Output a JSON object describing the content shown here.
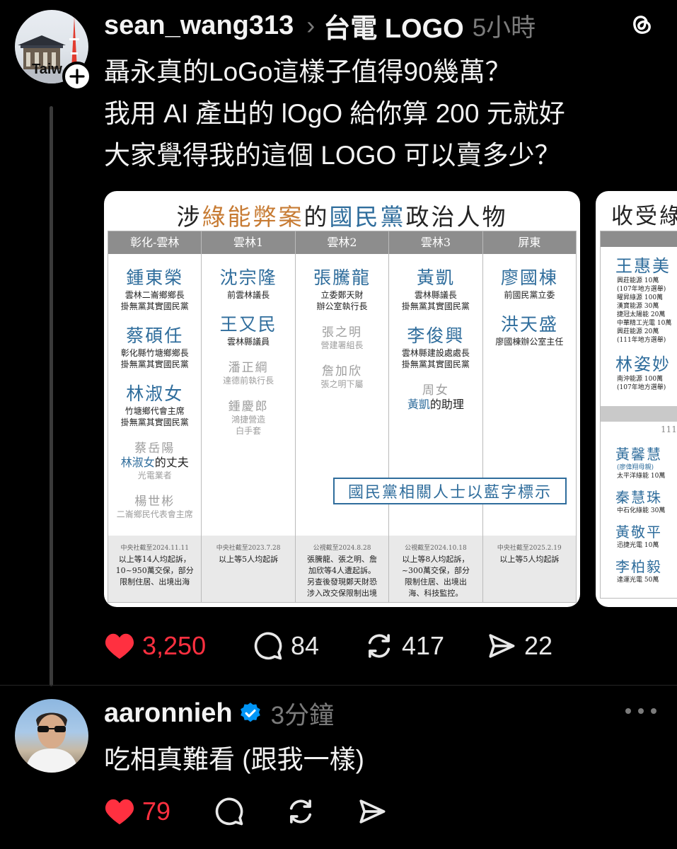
{
  "post": {
    "username": "sean_wang313",
    "separator": "›",
    "topic": "台電 LOGO",
    "time": "5小時",
    "avatar_label": "Taiw",
    "lines": [
      "聶永真的LoGo這樣子值得90幾萬？",
      "我用 AI 產出的 lOgO 給你算 200 元就好",
      "大家覺得我的這個 LOGO 可以賣多少？"
    ],
    "stats": {
      "likes": "3,250",
      "comments": "84",
      "reposts": "417",
      "shares": "22"
    }
  },
  "image1": {
    "title_parts": [
      "涉",
      "綠能弊案",
      "的",
      "國民黨",
      "政治人物"
    ],
    "columns": [
      {
        "header": "彰化-雲林",
        "people": [
          {
            "name": "鍾東榮",
            "titles": [
              "雲林二崙鄉鄉長",
              "掛無黨其實國民黨"
            ],
            "grey": false
          },
          {
            "name": "蔡碩任",
            "titles": [
              "彰化縣竹塘鄉鄉長",
              "掛無黨其實國民黨"
            ],
            "grey": false
          },
          {
            "name": "林淑女",
            "titles": [
              "竹塘鄉代會主席",
              "掛無黨其實國民黨"
            ],
            "grey": false
          },
          {
            "name": "蔡岳陽",
            "note_blue": "林淑女",
            "note_rest": "的丈夫",
            "titles": [
              "光電業者"
            ],
            "grey": true
          },
          {
            "name": "楊世彬",
            "titles": [
              "二崙鄉民代表會主席"
            ],
            "grey": true
          }
        ],
        "footer": {
          "source": "中央社截至2024.11.11",
          "lines": [
            "以上等14人均起訴，",
            "10~950萬交保，部分",
            "限制住居、出境出海"
          ]
        }
      },
      {
        "header": "雲林1",
        "people": [
          {
            "name": "沈宗隆",
            "titles": [
              "前雲林議長"
            ],
            "grey": false
          },
          {
            "name": "王又民",
            "titles": [
              "雲林縣議員"
            ],
            "grey": false
          },
          {
            "name": "潘正綱",
            "titles": [
              "達德前執行長"
            ],
            "grey": true
          },
          {
            "name": "鍾慶郎",
            "titles": [
              "鴻捷營造",
              "白手套"
            ],
            "grey": true
          }
        ],
        "footer": {
          "source": "中央社截至2023.7.28",
          "lines": [
            "以上等5人均起訴"
          ]
        }
      },
      {
        "header": "雲林2",
        "people": [
          {
            "name": "張騰龍",
            "titles": [
              "立委鄭天財",
              "辦公室執行長"
            ],
            "grey": false
          },
          {
            "name": "張之明",
            "titles": [
              "營建署組長"
            ],
            "grey": true
          },
          {
            "name": "詹加欣",
            "titles": [
              "張之明下屬"
            ],
            "grey": true
          }
        ],
        "footer": {
          "source": "公視截至2024.8.28",
          "lines": [
            "張騰龍、張之明、詹",
            "加欣等4人遭起訴。",
            "另查後發現鄭天財恐",
            "涉入改交保限制出境"
          ]
        }
      },
      {
        "header": "雲林3",
        "people": [
          {
            "name": "黃凱",
            "titles": [
              "雲林縣議長",
              "掛無黨其實國民黨"
            ],
            "grey": false
          },
          {
            "name": "李俊興",
            "titles": [
              "雲林縣建設處處長",
              "掛無黨其實國民黨"
            ],
            "grey": false
          },
          {
            "name": "周女",
            "note_blue": "黃凱",
            "note_rest": "的助理",
            "titles": [],
            "grey": true
          }
        ],
        "footer": {
          "source": "公視截至2024.10.18",
          "lines": [
            "以上等8人均起訴，",
            "~300萬交保，部分",
            "限制住居、出境出",
            "海、科技監控。"
          ]
        }
      },
      {
        "header": "屏東",
        "people": [
          {
            "name": "廖國棟",
            "titles": [
              "前國民黨立委"
            ],
            "grey": false
          },
          {
            "name": "洪天盛",
            "titles": [
              "廖國棟辦公室主任"
            ],
            "grey": false
          }
        ],
        "footer": {
          "source": "中央社截至2025.2.19",
          "lines": [
            "以上等5人均起訴"
          ]
        }
      }
    ],
    "legend": "國民黨相關人士以藍字標示"
  },
  "image2": {
    "title": "收受綠",
    "people_top": [
      {
        "name": "王惠美",
        "lines": [
          "興莊能源 10萬",
          "(107年地方選舉)",
          "曜昇綠源 100萬",
          "漢寶能源 30萬",
          "捷冠太陽能 20萬",
          "中華精工光電 10萬",
          "興莊能源 20萬",
          "(111年地方選舉)"
        ]
      },
      {
        "name": "林姿妙",
        "lines": [
          "南沖能源 100萬",
          "(107年地方選舉)"
        ]
      }
    ],
    "section_label": "111",
    "people_bottom": [
      {
        "name": "黃馨慧",
        "lines": [
          "(廖偉翔母親)",
          "太平洋綠能 10萬"
        ]
      },
      {
        "name": "秦慧珠",
        "lines": [
          "中石化綠能 30萬"
        ]
      },
      {
        "name": "黃敬平",
        "lines": [
          "迅捷光電 10萬"
        ]
      },
      {
        "name": "李柏毅",
        "lines": [
          "達運光電 50萬"
        ]
      }
    ]
  },
  "reply": {
    "username": "aaronnieh",
    "time": "3分鐘",
    "text": "吃相真難看 (跟我一樣)",
    "stats": {
      "likes": "79"
    }
  },
  "colors": {
    "background": "#000000",
    "like_red": "#ff3040",
    "muted": "#7b7b7b",
    "verified": "#0095f6",
    "kmt_blue": "#2f6d9c"
  }
}
